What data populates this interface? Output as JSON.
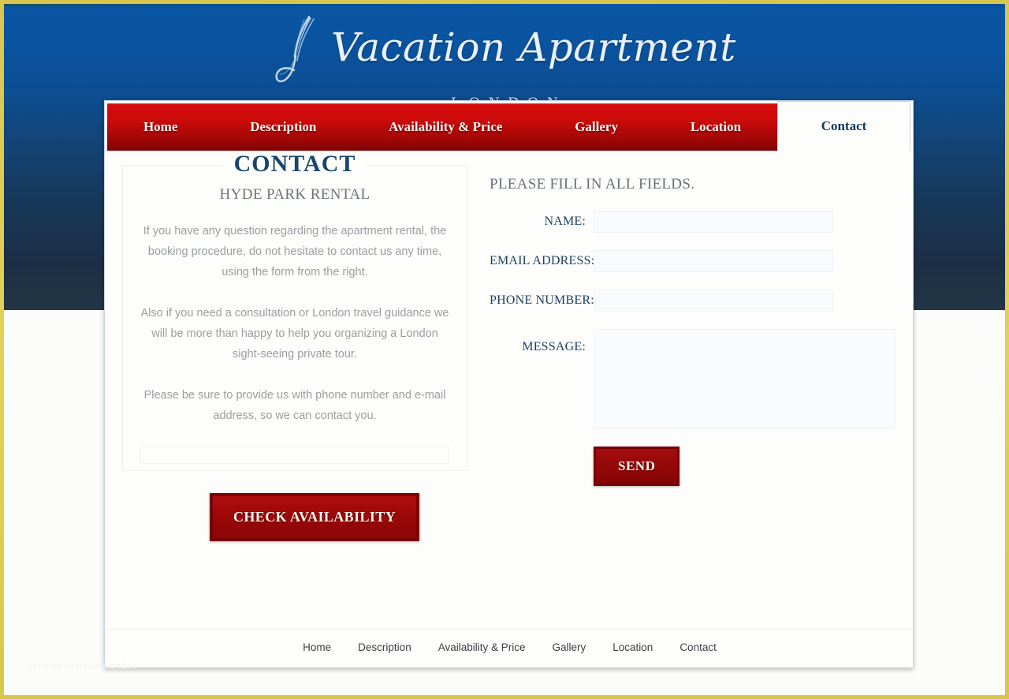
{
  "site": {
    "logo_word": "Vacation Apartment",
    "logo_sub": "LONDON",
    "ornament_icon": "feather-swirl-icon"
  },
  "colors": {
    "frame": "#dcc84e",
    "hero_top": "#0a56a4",
    "hero_bottom": "#223545",
    "nav_red": "#cc0a0a",
    "button_red": "#8b0505",
    "heading_navy": "#17456f",
    "label_navy": "#1d4062",
    "body_grey": "#9a9ea1"
  },
  "mainnav": {
    "items": [
      {
        "label": "Home",
        "active": false
      },
      {
        "label": "Description",
        "active": false
      },
      {
        "label": "Availability & Price",
        "active": false
      },
      {
        "label": "Gallery",
        "active": false
      },
      {
        "label": "Location",
        "active": false
      },
      {
        "label": "Contact",
        "active": true
      }
    ]
  },
  "left_panel": {
    "title": "CONTACT",
    "subtitle": "HYDE PARK RENTAL",
    "paragraphs": [
      "If you have any question regarding the apartment rental, the booking procedure, do not hesitate to contact us any time, using the form from the right.",
      "Also if you need a consultation or London travel guidance we will be more than happy to help you organizing a London sight-seeing private tour.",
      "Please be sure to provide us with phone number and e-mail address, so we can contact you."
    ],
    "check_button": "CHECK AVAILABILITY"
  },
  "form": {
    "heading": "PLEASE FILL IN ALL FIELDS.",
    "fields": [
      {
        "label": "NAME:",
        "value": "",
        "placeholder": ""
      },
      {
        "label": "EMAIL ADDRESS:",
        "value": "",
        "placeholder": ""
      },
      {
        "label": "PHONE NUMBER:",
        "value": "",
        "placeholder": ""
      }
    ],
    "message": {
      "label": "MESSAGE:",
      "value": "",
      "placeholder": ""
    },
    "send_button": "SEND"
  },
  "footer": {
    "links": [
      "Home",
      "Description",
      "Availability & Price",
      "Gallery",
      "Location",
      "Contact"
    ]
  },
  "watermark": "vacation apartment london"
}
